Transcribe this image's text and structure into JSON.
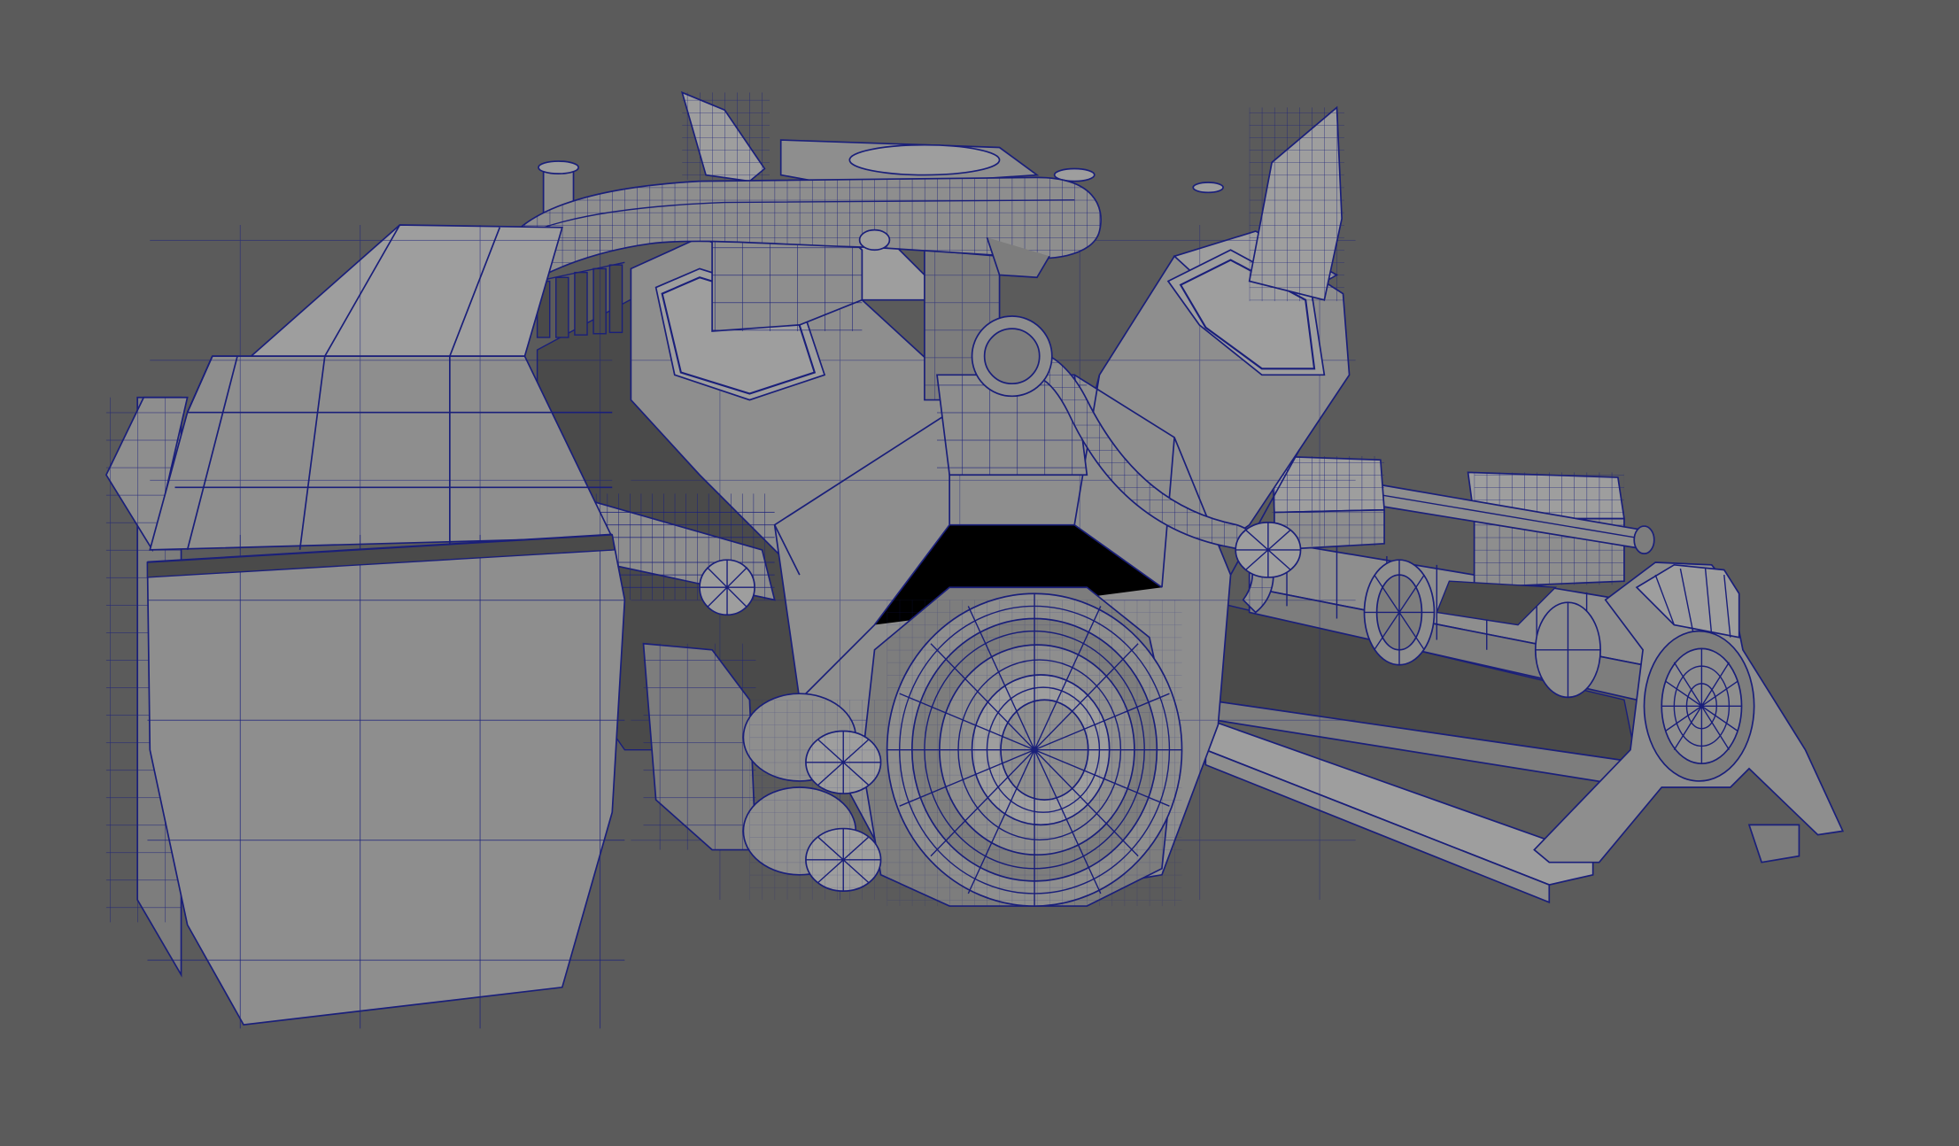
{
  "viewport": {
    "background": "#5b5b5b",
    "view_mode": "wireframe-on-shaded",
    "wire_color": "#1a1f7a",
    "surface_color": "#8e8e8e",
    "surface_light": "#9e9e9e",
    "surface_mid": "#7d7d7d",
    "surface_dark": "#4a4a4a",
    "shadow": "#333333"
  },
  "model": {
    "icon": "v-engine-mesh-icon"
  }
}
